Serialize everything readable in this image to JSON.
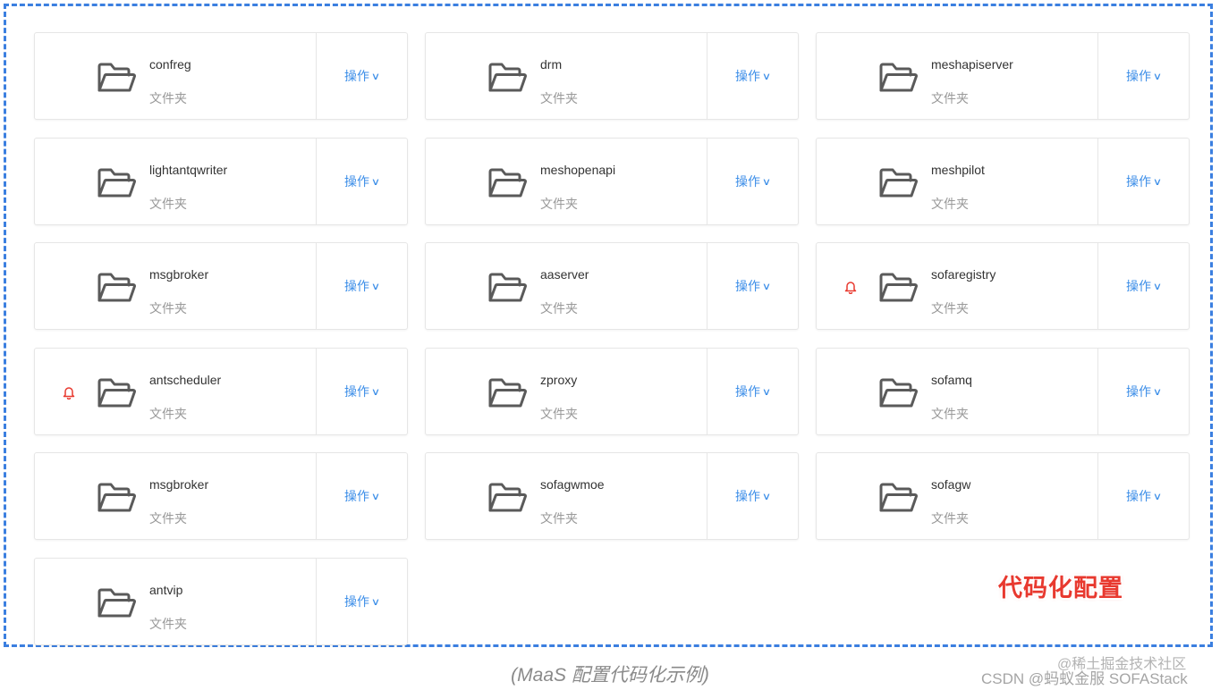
{
  "folders": [
    {
      "name": "confreg",
      "type": "文件夹",
      "action": "操作",
      "alert": false
    },
    {
      "name": "drm",
      "type": "文件夹",
      "action": "操作",
      "alert": false
    },
    {
      "name": "meshapiserver",
      "type": "文件夹",
      "action": "操作",
      "alert": false
    },
    {
      "name": "lightantqwriter",
      "type": "文件夹",
      "action": "操作",
      "alert": false
    },
    {
      "name": "meshopenapi",
      "type": "文件夹",
      "action": "操作",
      "alert": false
    },
    {
      "name": "meshpilot",
      "type": "文件夹",
      "action": "操作",
      "alert": false
    },
    {
      "name": "msgbroker",
      "type": "文件夹",
      "action": "操作",
      "alert": false
    },
    {
      "name": "aaserver",
      "type": "文件夹",
      "action": "操作",
      "alert": false
    },
    {
      "name": "sofaregistry",
      "type": "文件夹",
      "action": "操作",
      "alert": true
    },
    {
      "name": "antscheduler",
      "type": "文件夹",
      "action": "操作",
      "alert": true
    },
    {
      "name": "zproxy",
      "type": "文件夹",
      "action": "操作",
      "alert": false
    },
    {
      "name": "sofamq",
      "type": "文件夹",
      "action": "操作",
      "alert": false
    },
    {
      "name": "msgbroker",
      "type": "文件夹",
      "action": "操作",
      "alert": false
    },
    {
      "name": "sofagwmoe",
      "type": "文件夹",
      "action": "操作",
      "alert": false
    },
    {
      "name": "sofagw",
      "type": "文件夹",
      "action": "操作",
      "alert": false
    },
    {
      "name": "antvip",
      "type": "文件夹",
      "action": "操作",
      "alert": false
    }
  ],
  "icons": {
    "folder": "folder-open-icon",
    "alert": "bell-icon",
    "chevron": "chevron-down-icon"
  },
  "colors": {
    "accent": "#3c8ee8",
    "alert": "#e8392f",
    "border_dashed": "#3b7fe0"
  },
  "stamp": "代码化配置",
  "caption": "(MaaS 配置代码化示例)",
  "watermark_line1": "@稀土掘金技术社区",
  "watermark_line2": "CSDN @蚂蚁金服 SOFAStack"
}
